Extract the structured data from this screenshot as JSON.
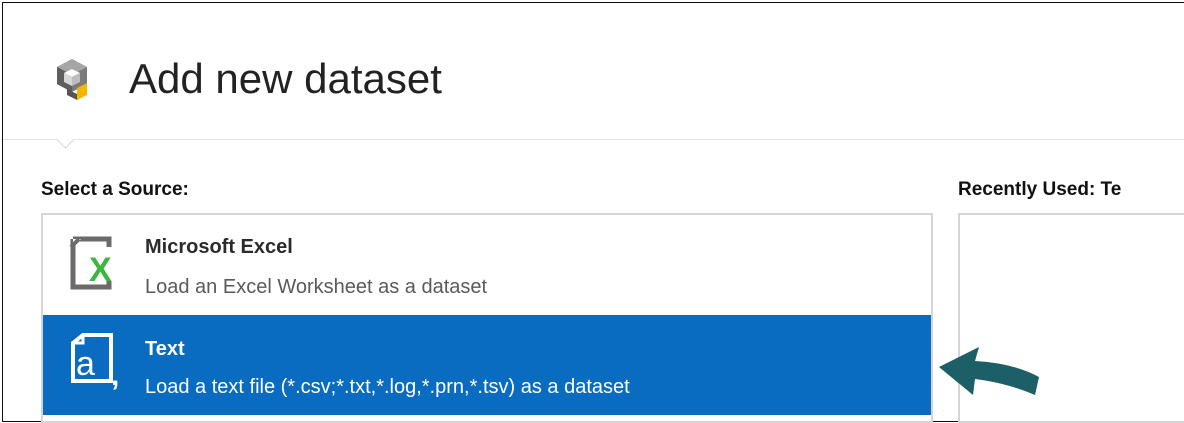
{
  "header": {
    "title": "Add new dataset",
    "icon": "dataset-cube-icon"
  },
  "source_section": {
    "label": "Select a Source:",
    "items": [
      {
        "title": "Microsoft Excel",
        "description": "Load an Excel Worksheet as a dataset",
        "icon": "excel-file-icon",
        "selected": false
      },
      {
        "title": "Text",
        "description": "Load a text file (*.csv;*.txt,*.log,*.prn,*.tsv) as a dataset",
        "icon": "text-file-icon",
        "selected": true
      }
    ]
  },
  "recent_section": {
    "label": "Recently Used: Te"
  },
  "colors": {
    "selected_bg": "#0a6cc1",
    "excel_green": "#3cb63c",
    "arrow": "#1d5f66",
    "cube_gray": "#6e6e6e",
    "cube_accent": "#f4b400"
  }
}
